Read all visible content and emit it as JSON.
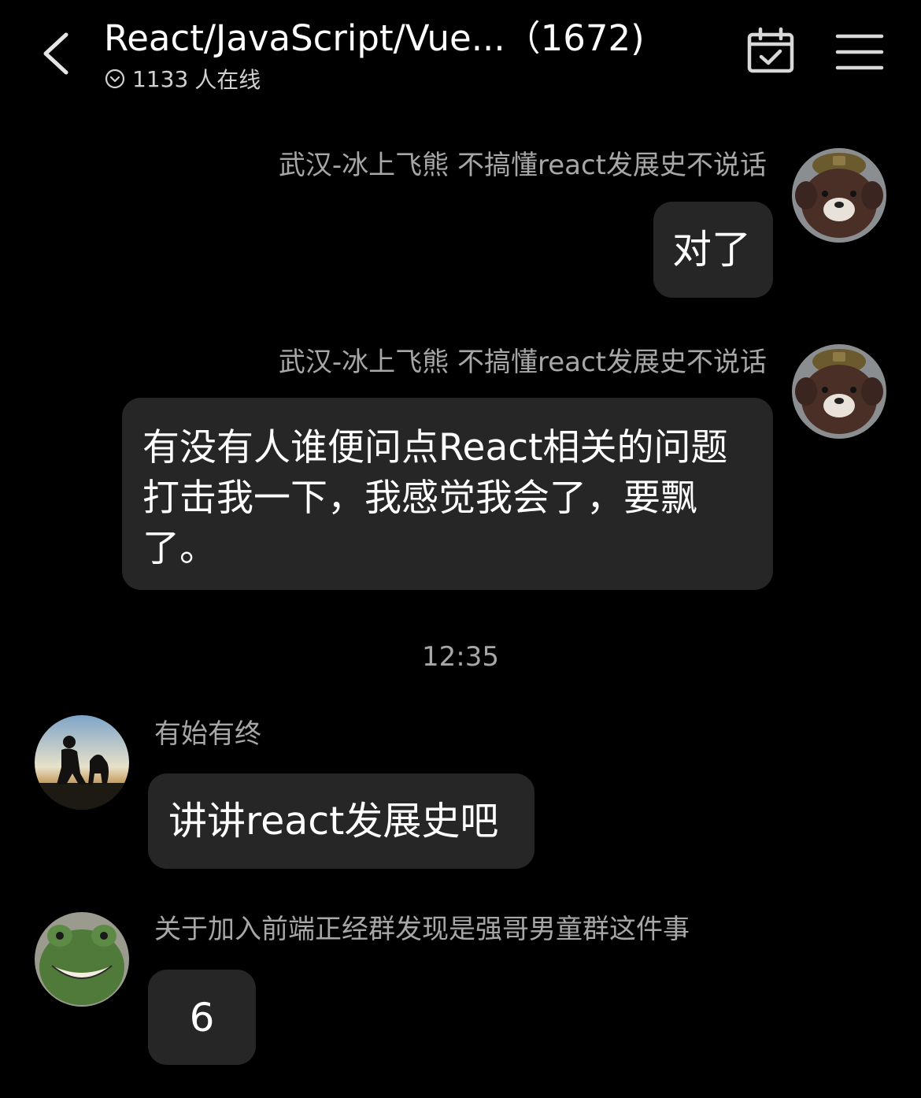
{
  "header": {
    "title": "React/JavaScript/Vue...（1672)",
    "online_count": "1133",
    "online_suffix": "人在线"
  },
  "icons": {
    "back": "back-chevron-icon",
    "online": "online-status-icon",
    "calendar": "calendar-check-icon",
    "menu": "hamburger-menu-icon"
  },
  "messages": [
    {
      "sender": "武汉-冰上飞熊 不搞懂react发展史不说话",
      "text": "对了",
      "side": "right",
      "avatar": "brown-bear-plush-avatar"
    },
    {
      "sender": "武汉-冰上飞熊 不搞懂react发展史不说话",
      "text": "有没有人谁便问点React相关的问题打击我一下，我感觉我会了，要飘了。",
      "side": "right",
      "avatar": "brown-bear-plush-avatar"
    },
    {
      "sender": "有始有终",
      "text": "讲讲react发展史吧",
      "side": "left",
      "avatar": "silhouette-with-dog-avatar"
    },
    {
      "sender": "关于加入前端正经群发现是强哥男童群这件事",
      "text": "6",
      "side": "left",
      "avatar": "green-frog-plush-avatar"
    }
  ],
  "timestamp": "12:35",
  "colors": {
    "background": "#000000",
    "bubble": "#262626",
    "name_text": "#a7a7a7",
    "text": "#ffffff"
  }
}
